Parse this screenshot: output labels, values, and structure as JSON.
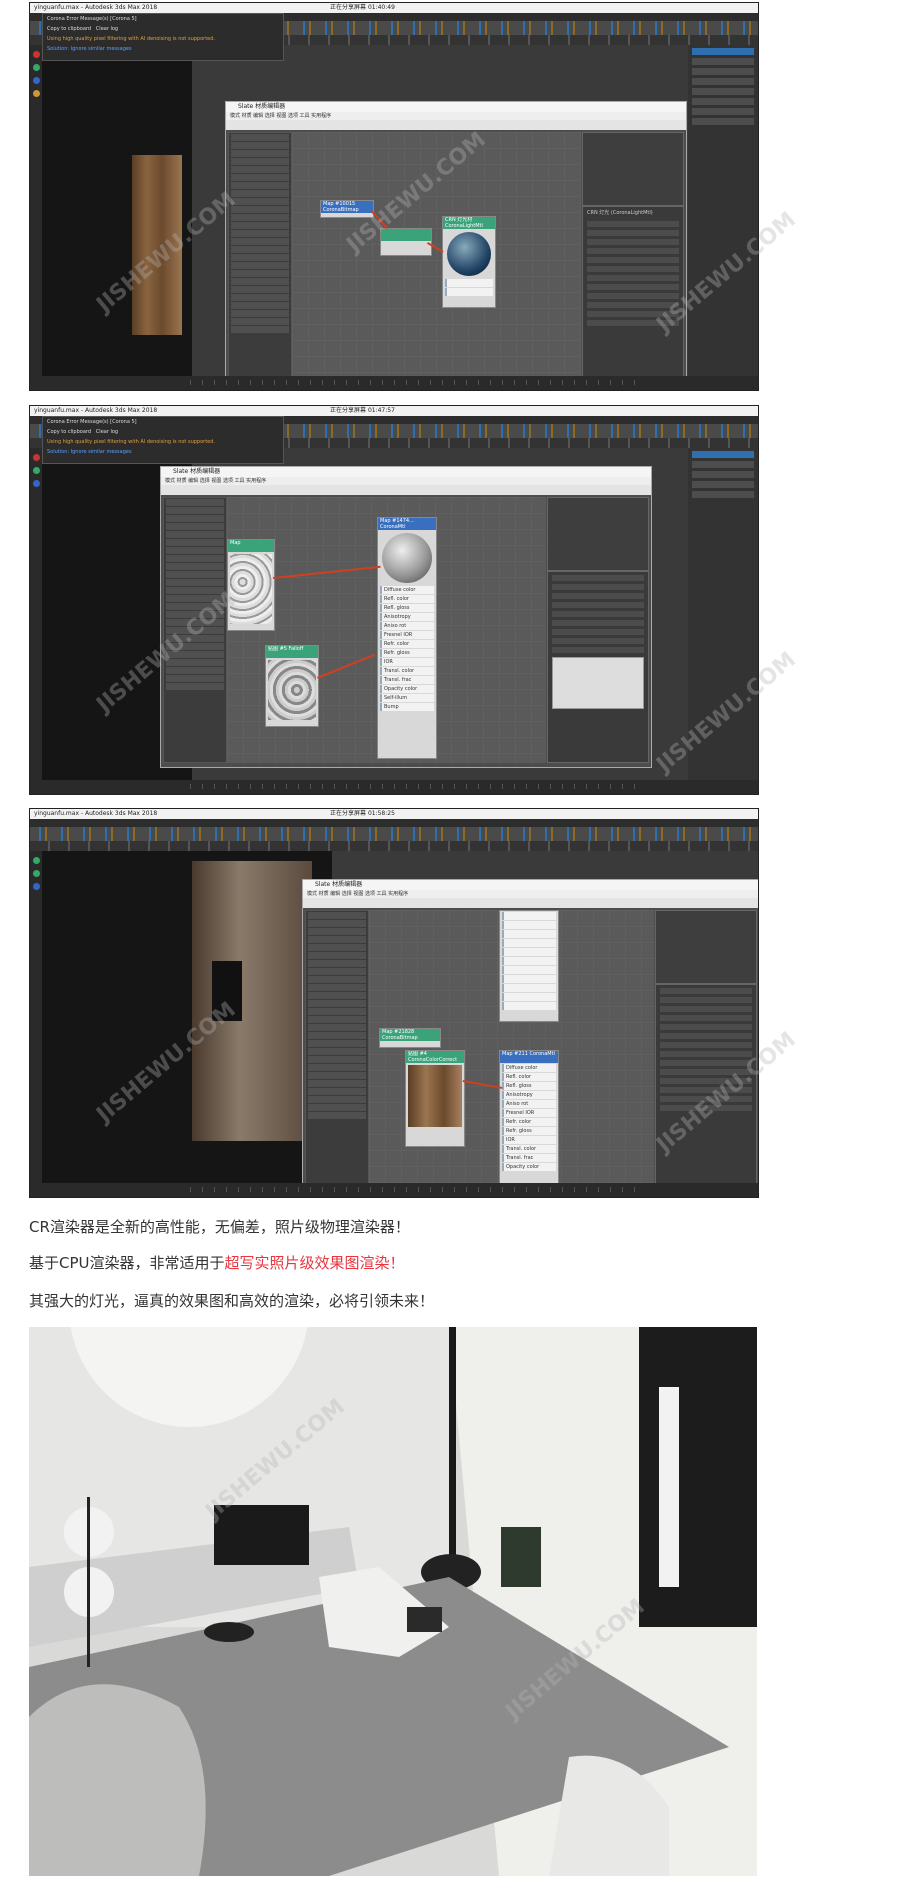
{
  "shots": [
    {
      "window_title": "yinguanfu.max - Autodesk 3ds Max 2018",
      "status_text": "正在分享屏幕",
      "timer": "01:40:49",
      "console_title": "Corona Error Message(s)   [Corona 5]",
      "console_copy": "Copy to clipboard",
      "console_clear": "Clear log",
      "console_warning": "Using high quality pixel filtering with AI denoising is not supported.",
      "console_link": "Solution: Ignore similar messages",
      "slate_title": "Slate 材质编辑器",
      "slate_menu": "模式  材质  编辑  选择  视图  选项  工具  实用程序",
      "node_a": "Map #10015 CoronaBitmap",
      "node_b": "CRN 灯光材 CoronaLightMtl",
      "params_header": "CRN 灯光 (CoronaLightMtl)"
    },
    {
      "window_title": "yinguanfu.max - Autodesk 3ds Max 2018",
      "status_text": "正在分享屏幕",
      "timer": "01:47:57",
      "console_title": "Corona Error Message(s)   [Corona 5]",
      "console_copy": "Copy to clipboard",
      "console_clear": "Clear log",
      "console_warning": "Using high quality pixel filtering with AI denoising is not supported.",
      "console_link": "Solution: Ignore similar messages",
      "slate_title": "Slate 材质编辑器",
      "slate_menu": "模式  材质  编辑  选择  视图  选项  工具  实用程序",
      "node_a": "Map",
      "node_b": "Map #1474... CoronaMtl",
      "node_c": "贴图 #5 Falloff",
      "slots": [
        "Diffuse color",
        "Refl. color",
        "Refl. gloss",
        "Anisotropy",
        "Aniso rot",
        "Fresnel IOR",
        "Refr. color",
        "Refr. gloss",
        "IOR",
        "Transl. color",
        "Transl. frac",
        "Opacity color",
        "Self-illum",
        "Bump"
      ]
    },
    {
      "window_title": "yinguanfu.max - Autodesk 3ds Max 2018",
      "status_text": "正在分享屏幕",
      "timer": "01:58:25",
      "slate_title": "Slate 材质编辑器",
      "slate_menu": "模式  材质  编辑  选择  视图  选项  工具  实用程序",
      "node_a": "Map #21828 CoronaBitmap",
      "node_b": "贴图 #4 CoronaColorCorrect",
      "node_c": "Map #211 CoronaMtl",
      "slots": [
        "Diffuse color",
        "Refl. color",
        "Refl. gloss",
        "Anisotropy",
        "Aniso rot",
        "Fresnel IOR",
        "Refr. color",
        "Refr. gloss",
        "IOR",
        "Transl. color",
        "Transl. frac",
        "Opacity color"
      ]
    }
  ],
  "captions": {
    "line1": "CR渲染器是全新的高性能，无偏差，照片级物理渲染器！",
    "line2_plain": "基于CPU渲染器，非常适用于",
    "line2_highlight": "超写实照片级效果图渲染！",
    "line3": "其强大的灯光，逼真的效果图和高效的渲染，必将引领未来！"
  },
  "watermark": "JISHEWU.COM",
  "colors": {
    "highlight": "#e8363f",
    "ui_dark": "#3a3a3a",
    "node_green": "#3aa37a",
    "wire": "#d04020"
  }
}
